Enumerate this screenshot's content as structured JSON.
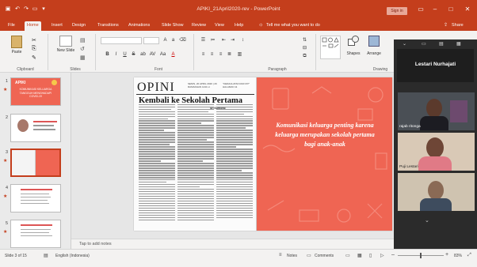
{
  "window": {
    "title": "APIKI_21April2020-rev - PowerPoint",
    "signin": "Sign in",
    "share": "Share",
    "tell_me": "Tell me what you want to do"
  },
  "tabs": [
    "File",
    "Home",
    "Insert",
    "Design",
    "Transitions",
    "Animations",
    "Slide Show",
    "Review",
    "View",
    "Help"
  ],
  "active_tab": "Home",
  "ribbon": {
    "paste": "Paste",
    "new_slide": "New Slide",
    "groups": [
      "Clipboard",
      "Slides",
      "Font",
      "Paragraph",
      "Drawing"
    ],
    "shapes": "Shapes",
    "arrange": "Arrange",
    "format_buttons": [
      "B",
      "I",
      "U",
      "S",
      "ab",
      "AV",
      "Aa",
      "A"
    ]
  },
  "thumbnails": [
    {
      "num": "1",
      "title": "APIKI",
      "caption": "KOMUNIKASI KELUARGA TANGGUH MENGHADAPI COVID-19"
    },
    {
      "num": "2",
      "title": "",
      "caption": ""
    },
    {
      "num": "3",
      "title": "",
      "caption": ""
    },
    {
      "num": "4",
      "title": "",
      "caption": ""
    },
    {
      "num": "5",
      "title": "",
      "caption": ""
    }
  ],
  "slide": {
    "newspaper": {
      "masthead": "OPINI",
      "date_line": "SENIN, 20 APRIL 2020 | 29 RAMADHAN 1441 H",
      "tagline": "\"KEDAULATAN RAKYAT\" HALAMAN 11",
      "headline": "Kembali ke Sekolah Pertama",
      "byline": "Sri Kurtiono"
    },
    "quote": "Komunikasi keluarga penting karena keluarga merupakan sekolah pertama bagi anak-anak"
  },
  "notes_placeholder": "Tap to add notes",
  "status": {
    "slide_count": "Slide 3 of 15",
    "language": "English (Indonesia)",
    "notes": "Notes",
    "comments": "Comments",
    "zoom": "83%"
  },
  "video": {
    "host_name": "Lestari Nurhajati",
    "participants": [
      "rajab ritonga",
      "Puji Lestari",
      ""
    ]
  }
}
